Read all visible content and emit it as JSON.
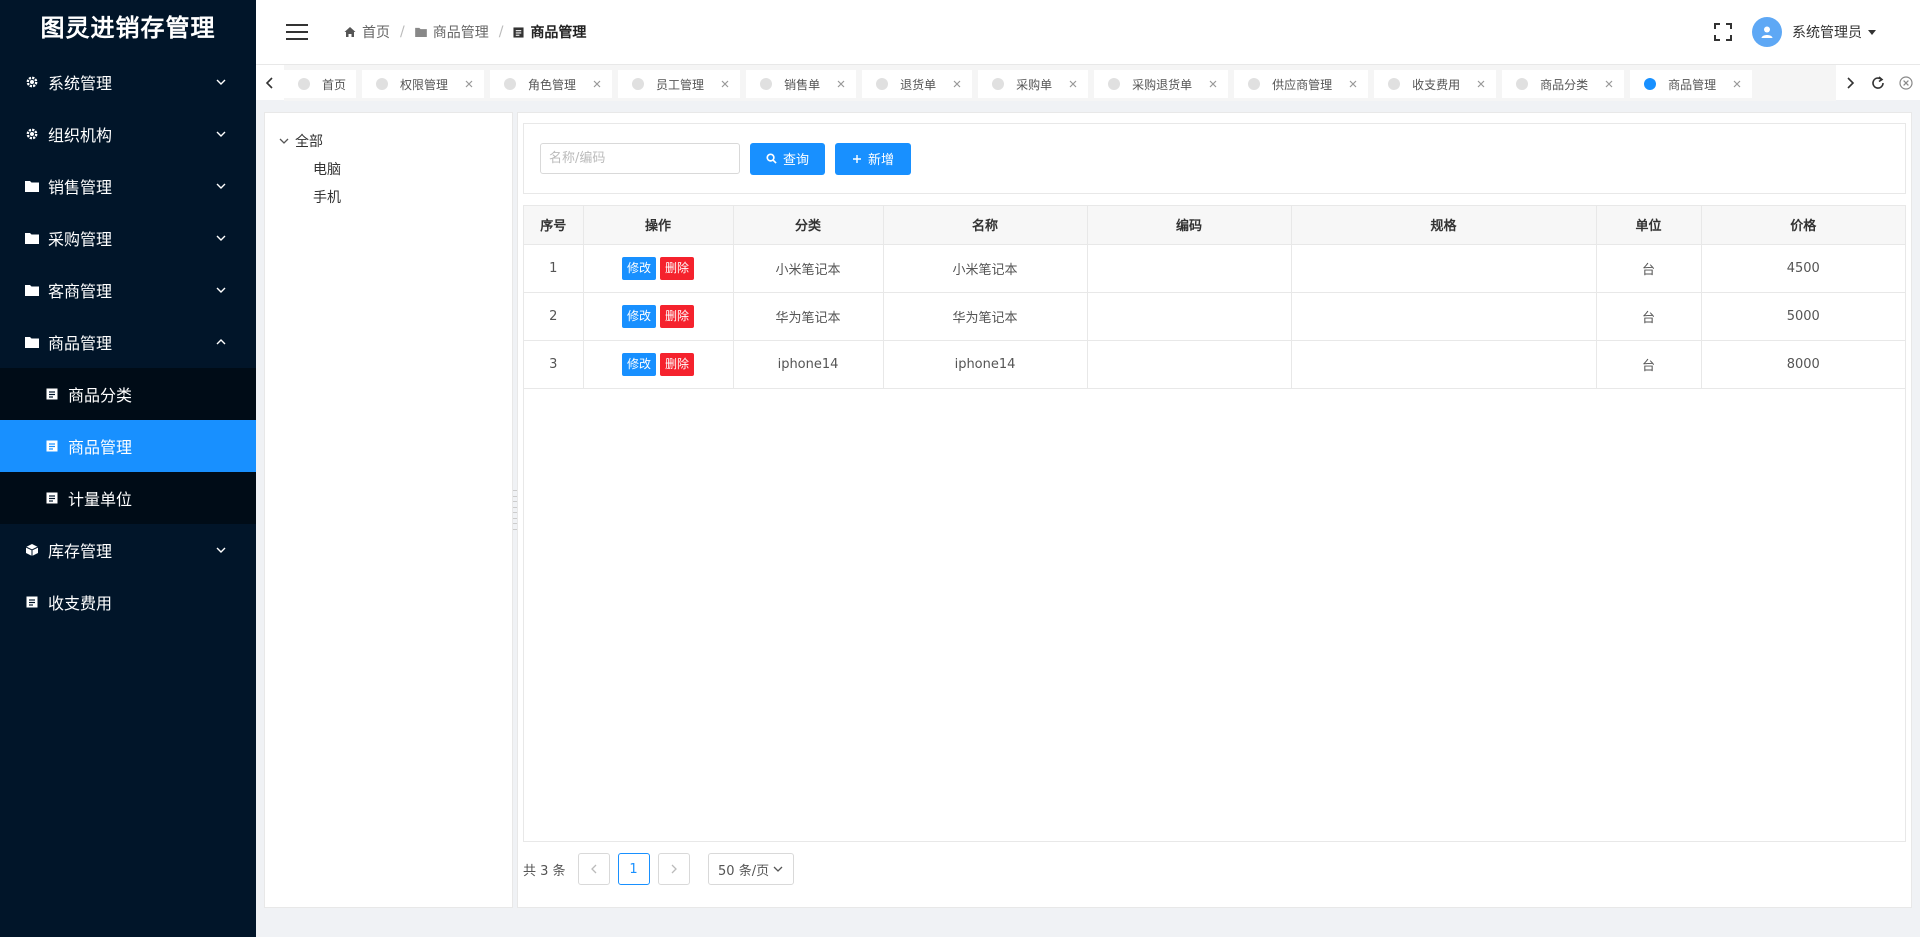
{
  "app": {
    "title": "图灵进销存管理"
  },
  "sidebar": {
    "items": [
      {
        "label": "系统管理",
        "icon": "gear-icon"
      },
      {
        "label": "组织机构",
        "icon": "gear-icon"
      },
      {
        "label": "销售管理",
        "icon": "folder-icon"
      },
      {
        "label": "采购管理",
        "icon": "folder-icon"
      },
      {
        "label": "客商管理",
        "icon": "folder-icon"
      },
      {
        "label": "商品管理",
        "icon": "folder-icon",
        "expanded": true
      },
      {
        "label": "库存管理",
        "icon": "box-icon"
      },
      {
        "label": "收支费用",
        "icon": "doc-icon"
      }
    ],
    "sub_items": [
      {
        "label": "商品分类",
        "icon": "doc-icon"
      },
      {
        "label": "商品管理",
        "icon": "doc-icon",
        "active": true
      },
      {
        "label": "计量单位",
        "icon": "doc-icon"
      }
    ]
  },
  "header": {
    "breadcrumb": [
      "首页",
      "商品管理",
      "商品管理"
    ],
    "user": "系统管理员"
  },
  "tabs": [
    "首页",
    "权限管理",
    "角色管理",
    "员工管理",
    "销售单",
    "退货单",
    "采购单",
    "采购退货单",
    "供应商管理",
    "收支费用",
    "商品分类",
    "商品管理"
  ],
  "active_tab": "商品管理",
  "tree": {
    "root": "全部",
    "children": [
      "电脑",
      "手机"
    ]
  },
  "search": {
    "placeholder": "名称/编码",
    "value": "",
    "query_label": "查询",
    "add_label": "新增"
  },
  "table": {
    "columns": [
      "序号",
      "操作",
      "分类",
      "名称",
      "编码",
      "规格",
      "单位",
      "价格"
    ],
    "edit_label": "修改",
    "delete_label": "删除",
    "rows": [
      {
        "no": "1",
        "category": "小米笔记本",
        "name": "小米笔记本",
        "code": "",
        "spec": "",
        "unit": "台",
        "price": "4500"
      },
      {
        "no": "2",
        "category": "华为笔记本",
        "name": "华为笔记本",
        "code": "",
        "spec": "",
        "unit": "台",
        "price": "5000"
      },
      {
        "no": "3",
        "category": "iphone14",
        "name": "iphone14",
        "code": "",
        "spec": "",
        "unit": "台",
        "price": "8000"
      }
    ]
  },
  "pagination": {
    "total_text": "共 3 条",
    "current_page": "1",
    "page_size": "50 条/页"
  },
  "colors": {
    "sidebar_bg": "#011529",
    "submenu_bg": "#000c17",
    "primary": "#1890ff",
    "danger": "#f5222d"
  }
}
